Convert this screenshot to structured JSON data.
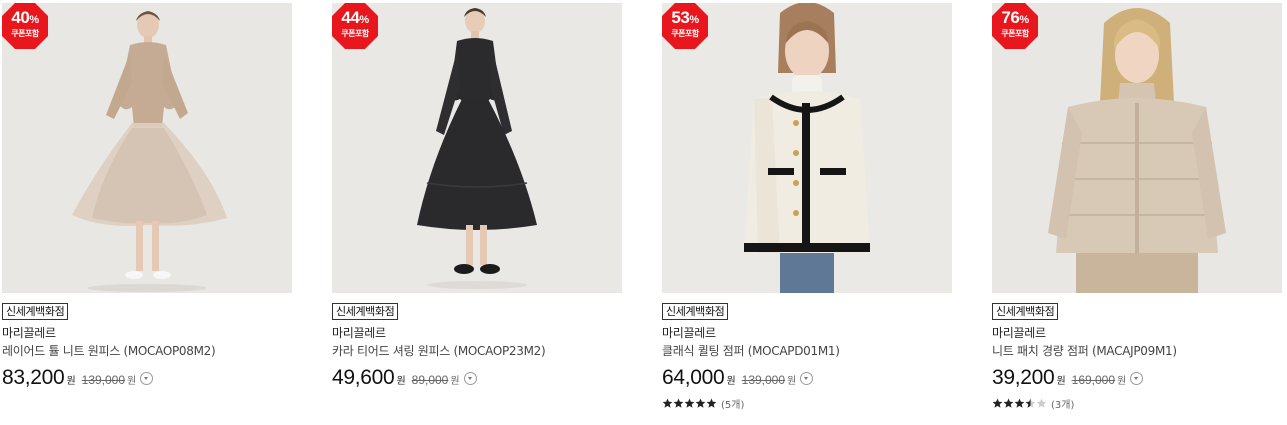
{
  "products": [
    {
      "discount": "40",
      "discount_symbol": "%",
      "coupon_label": "쿠폰포함",
      "store": "신세계백화점",
      "brand": "마리끌레르",
      "name": "레이어드 튤 니트 원피스 (MOCAOP08M2)",
      "price": "83,200",
      "currency": "원",
      "original_price": "139,000",
      "rating": null,
      "review_count": null,
      "image_icon": "model-beige-knit-tulle-dress"
    },
    {
      "discount": "44",
      "discount_symbol": "%",
      "coupon_label": "쿠폰포함",
      "store": "신세계백화점",
      "brand": "마리끌레르",
      "name": "카라 티어드 셔링 원피스 (MOCAOP23M2)",
      "price": "49,600",
      "currency": "원",
      "original_price": "89,000",
      "rating": null,
      "review_count": null,
      "image_icon": "model-black-tiered-dress"
    },
    {
      "discount": "53",
      "discount_symbol": "%",
      "coupon_label": "쿠폰포함",
      "store": "신세계백화점",
      "brand": "마리끌레르",
      "name": "클래식 퀼팅 점퍼 (MOCAPD01M1)",
      "price": "64,000",
      "currency": "원",
      "original_price": "139,000",
      "rating": 5,
      "review_count": "(5개)",
      "image_icon": "model-ivory-quilted-jacket"
    },
    {
      "discount": "76",
      "discount_symbol": "%",
      "coupon_label": "쿠폰포함",
      "store": "신세계백화점",
      "brand": "마리끌레르",
      "name": "니트 패치 경량 점퍼 (MACAJP09M1)",
      "price": "39,200",
      "currency": "원",
      "original_price": "169,000",
      "rating": 3.5,
      "review_count": "(3개)",
      "image_icon": "model-beige-light-padding"
    }
  ],
  "colors": {
    "badge": "#e8161d",
    "star": "#222222",
    "star_empty": "#cccccc"
  }
}
